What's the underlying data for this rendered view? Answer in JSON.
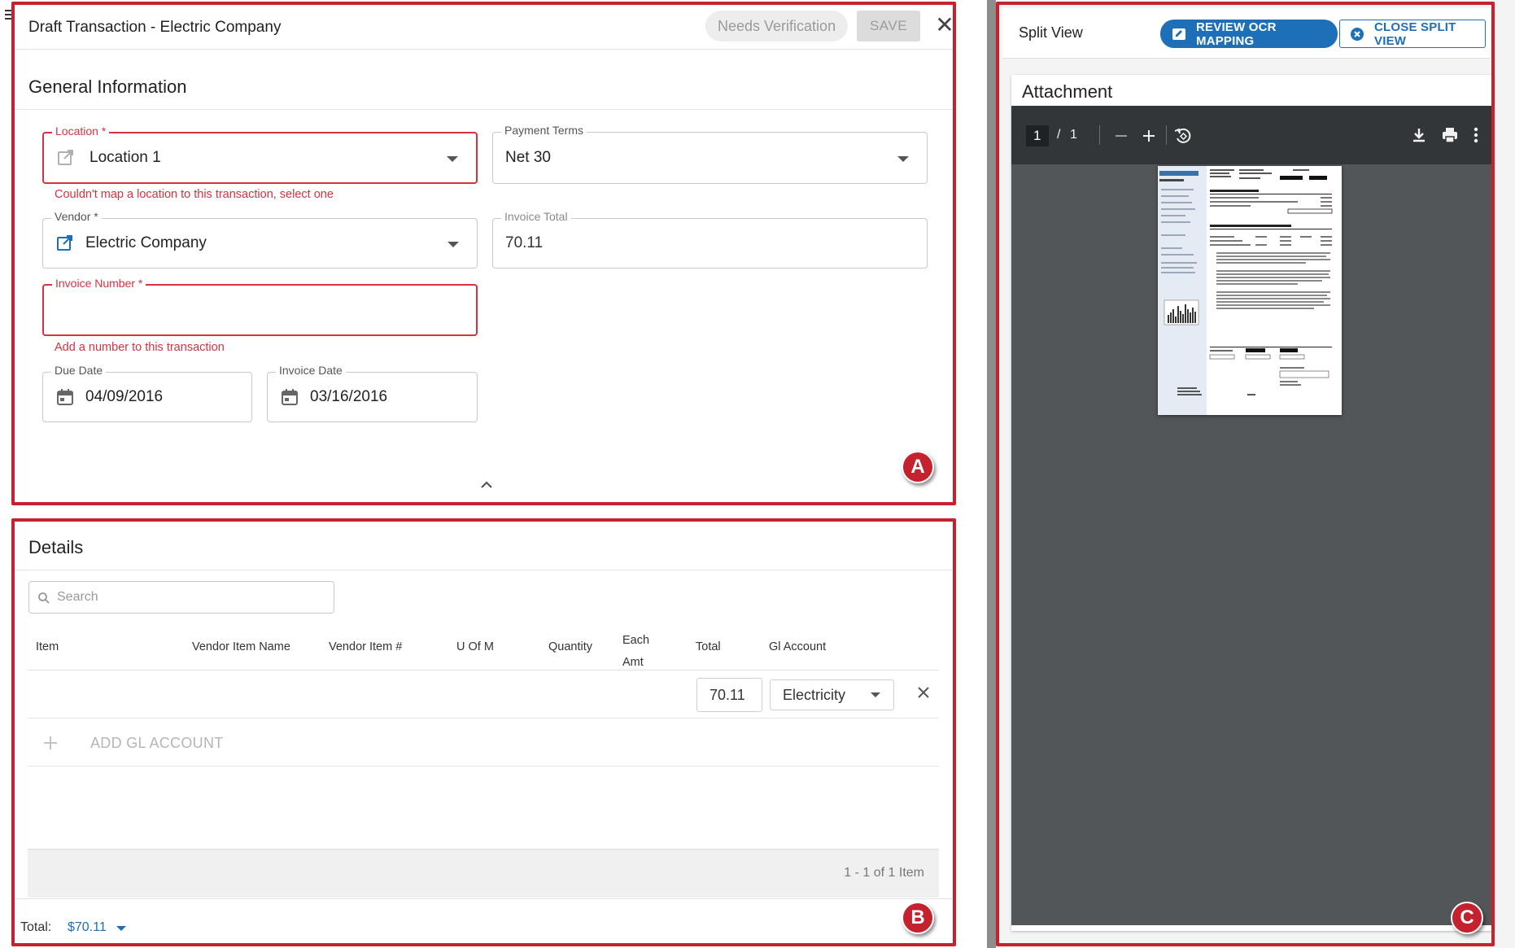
{
  "transaction": {
    "title": "Draft Transaction - Electric Company",
    "status_chip": "Needs Verification",
    "save_label": "SAVE",
    "close_glyph": "✕"
  },
  "general": {
    "title": "General Information",
    "location": {
      "label": "Location *",
      "value": "Location 1",
      "error": "Couldn't map a location to this transaction, select one",
      "icon": "open-in-new-icon"
    },
    "payment_terms": {
      "label": "Payment Terms",
      "value": "Net 30"
    },
    "vendor": {
      "label": "Vendor *",
      "value": "Electric Company",
      "icon": "open-in-new-icon"
    },
    "invoice_total": {
      "label": "Invoice Total",
      "value": "70.11"
    },
    "invoice_number": {
      "label": "Invoice Number *",
      "value": "",
      "error": "Add a number to this transaction"
    },
    "due_date": {
      "label": "Due Date",
      "value": "04/09/2016",
      "icon": "calendar-icon"
    },
    "invoice_date": {
      "label": "Invoice Date",
      "value": "03/16/2016",
      "icon": "calendar-icon"
    },
    "collapse_glyph": "⌃"
  },
  "details": {
    "title": "Details",
    "search_placeholder": "Search",
    "columns": [
      "Item",
      "Vendor Item Name",
      "Vendor Item #",
      "U Of M",
      "Quantity",
      "Each Amt",
      "Total",
      "Gl Account"
    ],
    "each_amt_line1": "Each",
    "each_amt_line2": "Amt",
    "row": {
      "total": "70.11",
      "gl_account": "Electricity"
    },
    "add_gl_label": "ADD GL ACCOUNT",
    "pager": "1 - 1 of 1 Item",
    "total_label": "Total:",
    "total_value": "$70.11"
  },
  "split_view": {
    "title": "Split View",
    "review_button": "REVIEW OCR MAPPING",
    "close_button": "CLOSE SPLIT VIEW",
    "attachment_title": "Attachment",
    "page_current": "1",
    "page_sep": "/",
    "page_total": "1"
  },
  "markers": {
    "a": "A",
    "b": "B",
    "c": "C"
  },
  "colors": {
    "accent": "#1d6fb8",
    "error": "#d63341",
    "frame": "#c4222e",
    "pdf_toolbar": "#323639",
    "pdf_canvas": "#525659"
  }
}
